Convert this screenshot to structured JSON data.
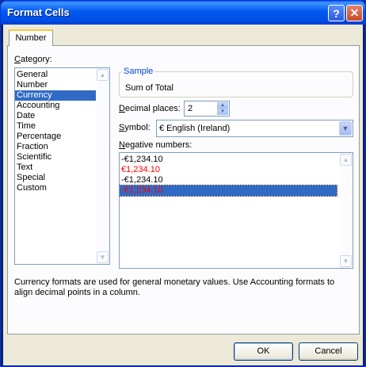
{
  "window": {
    "title": "Format Cells"
  },
  "titlebar_buttons": {
    "help": "?",
    "close": "✕"
  },
  "tabs": [
    {
      "label": "Number"
    }
  ],
  "category": {
    "label_underlined": "C",
    "label_rest": "ategory:",
    "items": [
      "General",
      "Number",
      "Currency",
      "Accounting",
      "Date",
      "Time",
      "Percentage",
      "Fraction",
      "Scientific",
      "Text",
      "Special",
      "Custom"
    ],
    "selected": "Currency"
  },
  "sample": {
    "label": "Sample",
    "value": "Sum of Total"
  },
  "decimal_places": {
    "label_underlined": "D",
    "label_rest": "ecimal places:",
    "value": "2"
  },
  "symbol": {
    "label_underlined": "S",
    "label_rest": "ymbol:",
    "value": "€ English (Ireland)"
  },
  "negative_numbers": {
    "label_underlined": "N",
    "label_rest": "egative numbers:",
    "items": [
      {
        "text": "-€1,234.10",
        "color": "#000000"
      },
      {
        "text": "€1,234.10",
        "color": "#ff0000"
      },
      {
        "text": "-€1,234.10",
        "color": "#000000"
      },
      {
        "text": "-€1,234.10",
        "color": "#ff0000"
      }
    ],
    "selected_index": 3
  },
  "description": "Currency formats are used for general monetary values.  Use Accounting formats to align decimal points in a column.",
  "buttons": {
    "ok": "OK",
    "cancel": "Cancel"
  },
  "colors": {
    "selection": "#316ac5",
    "negative_red": "#ff0000",
    "titlebar": "#0058ee"
  }
}
